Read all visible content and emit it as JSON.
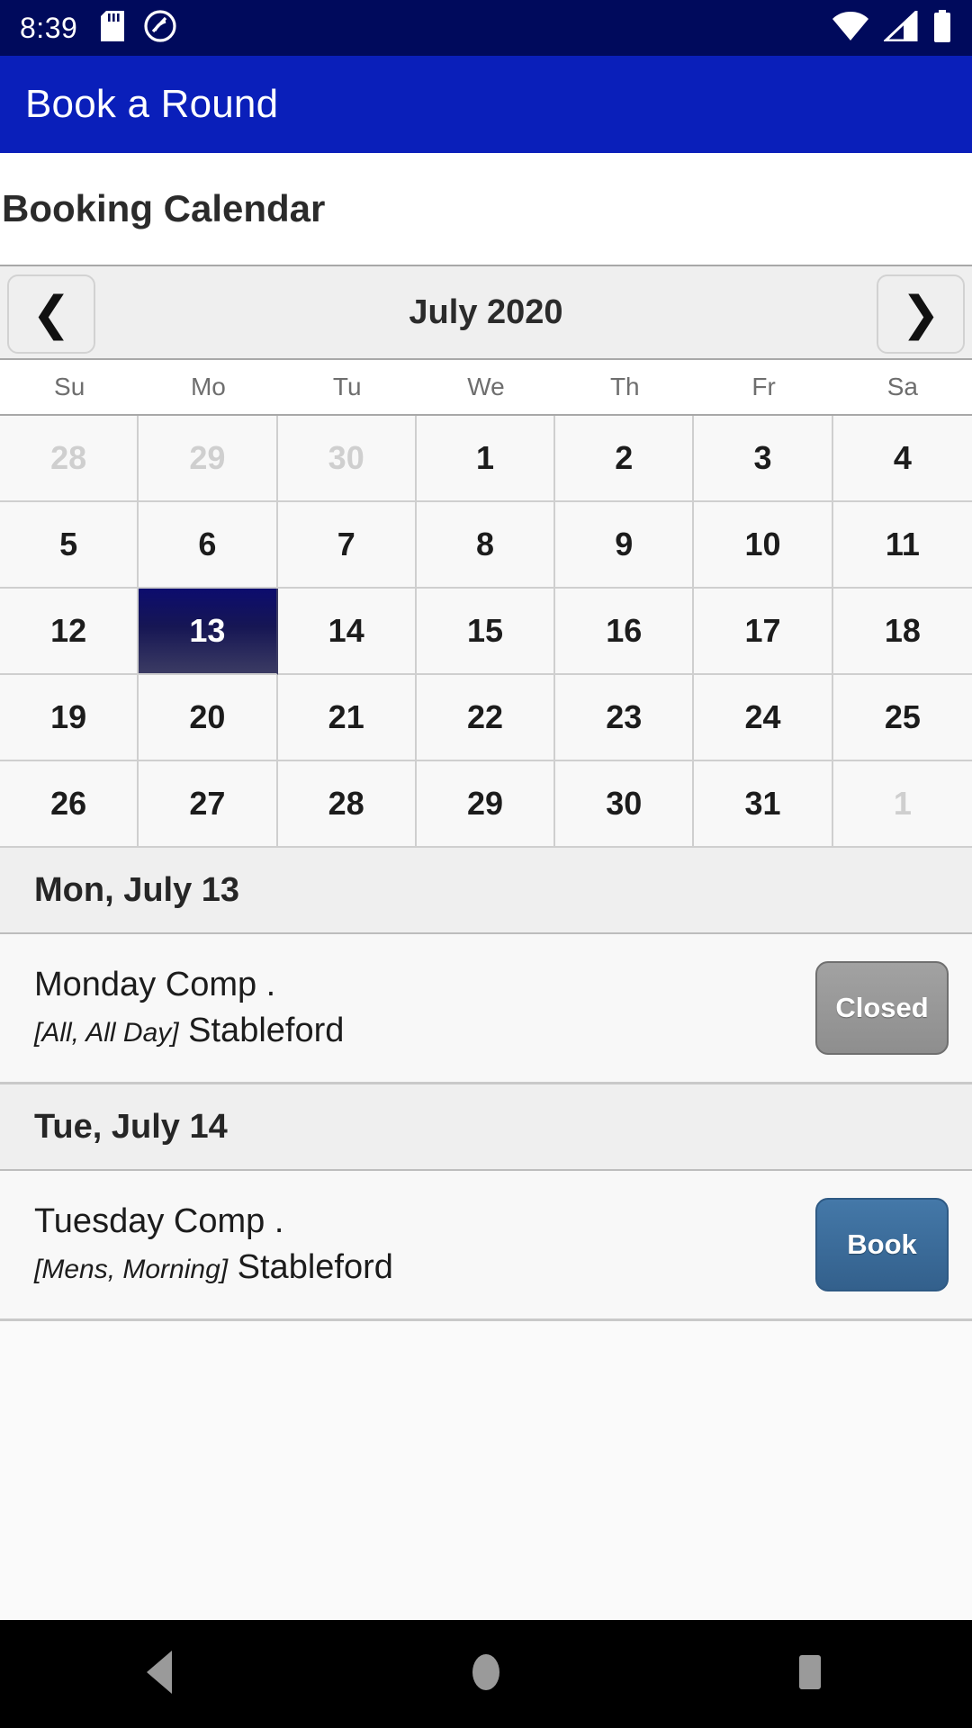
{
  "status_bar": {
    "time": "8:39",
    "icons_left": [
      "sd-card-icon",
      "android-auto-icon"
    ],
    "icons_right": [
      "wifi-icon",
      "cellular-signal-icon",
      "battery-icon"
    ],
    "background": "#000a5c"
  },
  "app_bar": {
    "title": "Book a Round",
    "background": "#0a1fba"
  },
  "page": {
    "title": "Booking Calendar"
  },
  "calendar": {
    "month_label": "July 2020",
    "prev_label": "❮",
    "next_label": "❯",
    "weekdays": [
      "Su",
      "Mo",
      "Tu",
      "We",
      "Th",
      "Fr",
      "Sa"
    ],
    "selected_day": "13",
    "selected_color": "#0c0c6e",
    "days": [
      {
        "label": "28",
        "muted": true,
        "selected": false
      },
      {
        "label": "29",
        "muted": true,
        "selected": false
      },
      {
        "label": "30",
        "muted": true,
        "selected": false
      },
      {
        "label": "1",
        "muted": false,
        "selected": false
      },
      {
        "label": "2",
        "muted": false,
        "selected": false
      },
      {
        "label": "3",
        "muted": false,
        "selected": false
      },
      {
        "label": "4",
        "muted": false,
        "selected": false
      },
      {
        "label": "5",
        "muted": false,
        "selected": false
      },
      {
        "label": "6",
        "muted": false,
        "selected": false
      },
      {
        "label": "7",
        "muted": false,
        "selected": false
      },
      {
        "label": "8",
        "muted": false,
        "selected": false
      },
      {
        "label": "9",
        "muted": false,
        "selected": false
      },
      {
        "label": "10",
        "muted": false,
        "selected": false
      },
      {
        "label": "11",
        "muted": false,
        "selected": false
      },
      {
        "label": "12",
        "muted": false,
        "selected": false
      },
      {
        "label": "13",
        "muted": false,
        "selected": true
      },
      {
        "label": "14",
        "muted": false,
        "selected": false
      },
      {
        "label": "15",
        "muted": false,
        "selected": false
      },
      {
        "label": "16",
        "muted": false,
        "selected": false
      },
      {
        "label": "17",
        "muted": false,
        "selected": false
      },
      {
        "label": "18",
        "muted": false,
        "selected": false
      },
      {
        "label": "19",
        "muted": false,
        "selected": false
      },
      {
        "label": "20",
        "muted": false,
        "selected": false
      },
      {
        "label": "21",
        "muted": false,
        "selected": false
      },
      {
        "label": "22",
        "muted": false,
        "selected": false
      },
      {
        "label": "23",
        "muted": false,
        "selected": false
      },
      {
        "label": "24",
        "muted": false,
        "selected": false
      },
      {
        "label": "25",
        "muted": false,
        "selected": false
      },
      {
        "label": "26",
        "muted": false,
        "selected": false
      },
      {
        "label": "27",
        "muted": false,
        "selected": false
      },
      {
        "label": "28",
        "muted": false,
        "selected": false
      },
      {
        "label": "29",
        "muted": false,
        "selected": false
      },
      {
        "label": "30",
        "muted": false,
        "selected": false
      },
      {
        "label": "31",
        "muted": false,
        "selected": false
      },
      {
        "label": "1",
        "muted": true,
        "selected": false
      }
    ]
  },
  "agenda": [
    {
      "day_label": "Mon, July 13",
      "events": [
        {
          "title": "Monday Comp .",
          "tag": "[All, All Day]",
          "format": "Stableford",
          "button_label": "Closed",
          "button_state": "closed",
          "button_color": "#8e8e8e"
        }
      ]
    },
    {
      "day_label": "Tue, July 14",
      "events": [
        {
          "title": "Tuesday Comp .",
          "tag": "[Mens, Morning]",
          "format": "Stableford",
          "button_label": "Book",
          "button_state": "book",
          "button_color": "#33608c"
        }
      ]
    }
  ],
  "nav_bar": {
    "buttons": [
      "back-icon",
      "home-icon",
      "recents-icon"
    ],
    "background": "#000000"
  }
}
